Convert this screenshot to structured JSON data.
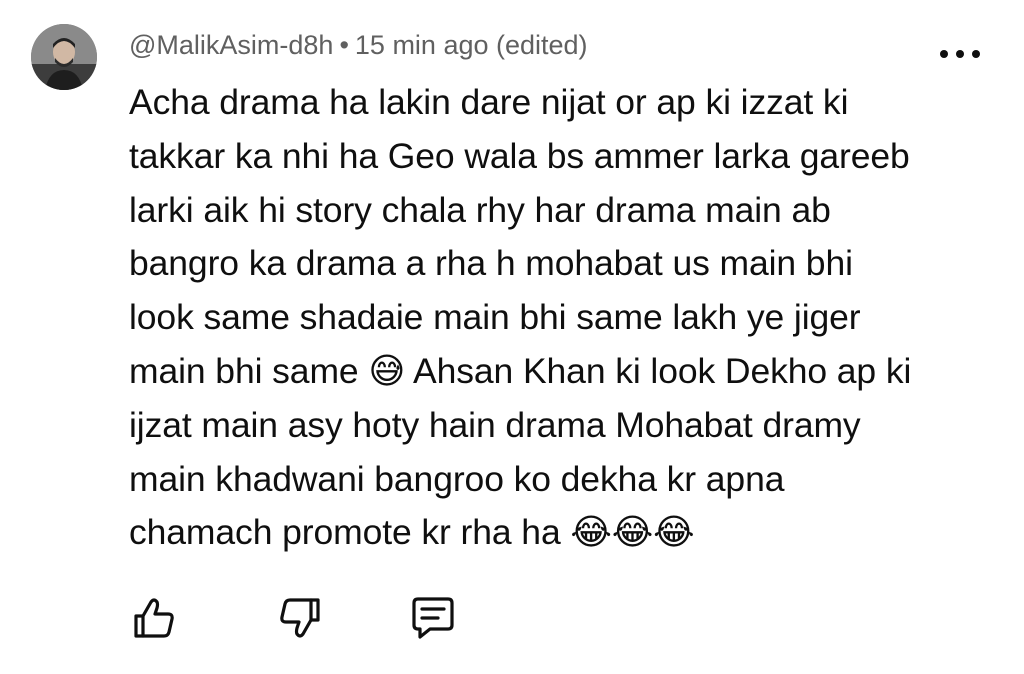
{
  "comment": {
    "author": "@MalikAsim-d8h",
    "separator": "•",
    "timestamp": "15 min ago (edited)",
    "text": "Acha drama ha lakin dare nijat or ap ki izzat ki\ntakkar ka nhi ha Geo wala bs ammer larka gareeb\nlarki aik hi story chala rhy har drama main ab\nbangro ka drama a rha h mohabat us main bhi\nlook same shadaie main bhi same  lakh ye jiger\nmain bhi same 😅 Ahsan Khan ki look Dekho ap ki\nijzat main asy hoty hain drama Mohabat dramy\nmain khadwani bangroo ko dekha kr apna\nchamach promote kr rha ha 😂😂😂"
  },
  "icons": {
    "avatar": "user-avatar",
    "more": "more-options-icon",
    "like": "thumbs-up-icon",
    "dislike": "thumbs-down-icon",
    "reply": "reply-comment-icon"
  },
  "colors": {
    "text": "#0f0f0f",
    "meta": "#606060",
    "background": "#ffffff"
  }
}
